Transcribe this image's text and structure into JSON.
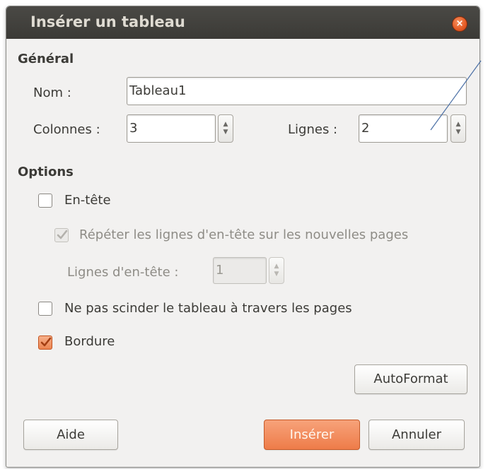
{
  "dialog": {
    "title": "Insérer un tableau",
    "close_glyph": "×"
  },
  "general": {
    "heading": "Général",
    "name_label": "Nom :",
    "name_value": "Tableau1",
    "columns_label": "Colonnes :",
    "columns_value": "3",
    "rows_label": "Lignes :",
    "rows_value": "2"
  },
  "options": {
    "heading": "Options",
    "header_label": "En-tête",
    "header_checked": false,
    "repeat_label": "Répéter les lignes d'en-tête sur les nouvelles pages",
    "repeat_checked": true,
    "repeat_disabled": true,
    "header_rows_label": "Lignes d'en-tête :",
    "header_rows_value": "1",
    "no_split_label": "Ne pas scinder le tableau à travers les pages",
    "no_split_checked": false,
    "border_label": "Bordure",
    "border_checked": true
  },
  "buttons": {
    "autoformat": "AutoFormat",
    "help": "Aide",
    "insert": "Insérer",
    "cancel": "Annuler"
  },
  "spinner": {
    "up_glyph": "▲",
    "down_glyph": "▼"
  },
  "icons": {
    "close": "close-icon",
    "check": "checkmark-icon",
    "spin_up": "spin-up-icon",
    "spin_down": "spin-down-icon"
  },
  "colors": {
    "titlebar": "#3b3a36",
    "accent": "#ee7c49",
    "window_bg": "#f2f1f0"
  }
}
